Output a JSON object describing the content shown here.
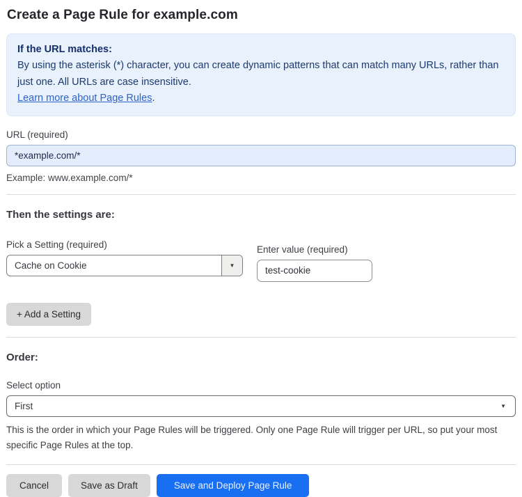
{
  "page": {
    "title": "Create a Page Rule for example.com"
  },
  "info_box": {
    "heading": "If the URL matches:",
    "body": "By using the asterisk (*) character, you can create dynamic patterns that can match many URLs, rather than just one. All URLs are case insensitive.",
    "link_label": "Learn more about Page Rules",
    "link_suffix": "."
  },
  "url_field": {
    "label": "URL (required)",
    "value": "*example.com/*",
    "helper": "Example: www.example.com/*"
  },
  "settings": {
    "heading": "Then the settings are:",
    "setting_select": {
      "label": "Pick a Setting (required)",
      "value": "Cache on Cookie"
    },
    "value_field": {
      "label": "Enter value (required)",
      "value": "test-cookie"
    },
    "add_button_label": "+ Add a Setting"
  },
  "order": {
    "heading": "Order:",
    "select_label": "Select option",
    "select_value": "First",
    "helper": "This is the order in which your Page Rules will be triggered. Only one Page Rule will trigger per URL, so put your most specific Page Rules at the top."
  },
  "actions": {
    "cancel_label": "Cancel",
    "save_draft_label": "Save as Draft",
    "save_deploy_label": "Save and Deploy Page Rule"
  },
  "colors": {
    "info_box_bg": "#e9f1fc",
    "info_text": "#1d3a6d",
    "link": "#2d63c8",
    "url_input_bg": "#e3edfc",
    "primary_button": "#186ff2",
    "secondary_button": "#d8d8d8"
  },
  "icons": {
    "dropdown_arrow": "▼"
  }
}
